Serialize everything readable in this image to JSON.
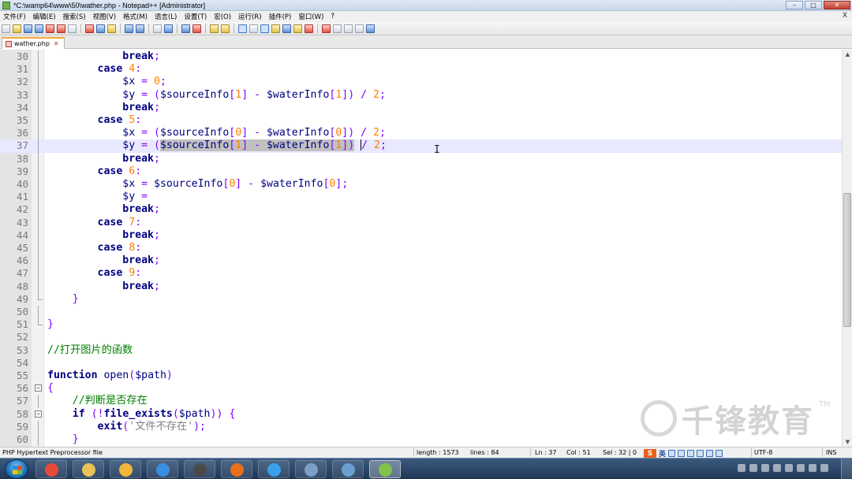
{
  "window": {
    "title": "*C:\\wamp64\\www\\50\\wather.php - Notepad++ [Administrator]",
    "minimize": "–",
    "maximize": "□",
    "close": "✕"
  },
  "menu": {
    "items": [
      "文件(F)",
      "编辑(E)",
      "搜索(S)",
      "视图(V)",
      "格式(M)",
      "语言(L)",
      "设置(T)",
      "宏(O)",
      "运行(R)",
      "插件(P)",
      "窗口(W)",
      "?"
    ],
    "close_mark": "X"
  },
  "tab": {
    "label": "wather.php",
    "close": "✕"
  },
  "editor": {
    "lines": [
      {
        "n": "30",
        "fold": "vline"
      },
      {
        "n": "31",
        "fold": "vline"
      },
      {
        "n": "32",
        "fold": "vline"
      },
      {
        "n": "33",
        "fold": "vline"
      },
      {
        "n": "34",
        "fold": "vline"
      },
      {
        "n": "35",
        "fold": "vline"
      },
      {
        "n": "36",
        "fold": "vline"
      },
      {
        "n": "37",
        "fold": "vline"
      },
      {
        "n": "38",
        "fold": "vline"
      },
      {
        "n": "39",
        "fold": "vline"
      },
      {
        "n": "40",
        "fold": "vline"
      },
      {
        "n": "41",
        "fold": "vline"
      },
      {
        "n": "42",
        "fold": "vline"
      },
      {
        "n": "43",
        "fold": "vline"
      },
      {
        "n": "44",
        "fold": "vline"
      },
      {
        "n": "45",
        "fold": "vline"
      },
      {
        "n": "46",
        "fold": "vline"
      },
      {
        "n": "47",
        "fold": "vline"
      },
      {
        "n": "48",
        "fold": "vline"
      },
      {
        "n": "49",
        "fold": "end"
      },
      {
        "n": "50",
        "fold": "vline"
      },
      {
        "n": "51",
        "fold": "end"
      },
      {
        "n": "52",
        "fold": "none"
      },
      {
        "n": "53",
        "fold": "none"
      },
      {
        "n": "54",
        "fold": "none"
      },
      {
        "n": "55",
        "fold": "none"
      },
      {
        "n": "56",
        "fold": "box"
      },
      {
        "n": "57",
        "fold": "vline"
      },
      {
        "n": "58",
        "fold": "box"
      },
      {
        "n": "59",
        "fold": "vline"
      },
      {
        "n": "60",
        "fold": "vline"
      }
    ],
    "current_line_index": 7,
    "fold_box_glyph": "−",
    "code": {
      "l30_kw": "break",
      "l31_kw": "case",
      "l31_num": "4",
      "l32_var": "$x",
      "l32_num": "0",
      "l33_var": "$y",
      "l33_v1": "$sourceInfo",
      "l33_v2": "$waterInfo",
      "l33_i1": "1",
      "l33_i2": "1",
      "l33_d": "2",
      "l34_kw": "break",
      "l35_kw": "case",
      "l35_num": "5",
      "l36_var": "$x",
      "l36_v1": "$sourceInfo",
      "l36_v2": "$waterInfo",
      "l36_i1": "0",
      "l36_i2": "0",
      "l36_d": "2",
      "l37_var": "$y",
      "l37_v1": "$sourceInfo",
      "l37_v2": "$waterInfo",
      "l37_i1": "1",
      "l37_i2": "1",
      "l37_d": "2",
      "l38_kw": "break",
      "l39_kw": "case",
      "l39_num": "6",
      "l40_var": "$x",
      "l40_v1": "$sourceInfo",
      "l40_v2": "$waterInfo",
      "l40_i1": "0",
      "l40_i2": "0",
      "l41_var": "$y",
      "l42_kw": "break",
      "l43_kw": "case",
      "l43_num": "7",
      "l44_kw": "break",
      "l45_kw": "case",
      "l45_num": "8",
      "l46_kw": "break",
      "l47_kw": "case",
      "l47_num": "9",
      "l48_kw": "break",
      "l49_brace": "}",
      "l51_brace": "}",
      "l53_comment": "//打开图片的函数",
      "l55_kw": "function",
      "l55_name": "open",
      "l55_param": "$path",
      "l56_brace": "{",
      "l57_comment": "//判断是否存在",
      "l58_kw": "if",
      "l58_fn": "file_exists",
      "l58_param": "$path",
      "l59_kw": "exit",
      "l59_str": "'文件不存在'",
      "l60_brace": "}"
    }
  },
  "watermark": {
    "text": "千锋教育",
    "tm": "TM"
  },
  "status": {
    "filetype": "PHP Hypertext Preprocessor file",
    "length": "length : 1573",
    "lines": "lines : 84",
    "ln": "Ln : 37",
    "col": "Col : 51",
    "sel": "Sel : 32 | 0",
    "ime_logo": "S",
    "ime_lang": "英",
    "encoding": "UTF-8",
    "mode": "INS"
  },
  "taskbar": {
    "apps": [
      {
        "name": "chrome",
        "color": "#e84a3a"
      },
      {
        "name": "explorer",
        "color": "#e9c35a"
      },
      {
        "name": "paw",
        "color": "#f2b63a"
      },
      {
        "name": "ie",
        "color": "#3a8fe0"
      },
      {
        "name": "sublime",
        "color": "#4a4a4a"
      },
      {
        "name": "firefox",
        "color": "#e8701c"
      },
      {
        "name": "sogou",
        "color": "#3aa0e8"
      },
      {
        "name": "store",
        "color": "#7aa0c8"
      },
      {
        "name": "folder",
        "color": "#6aa0d0"
      },
      {
        "name": "notepadpp",
        "color": "#7fc24a"
      }
    ]
  }
}
